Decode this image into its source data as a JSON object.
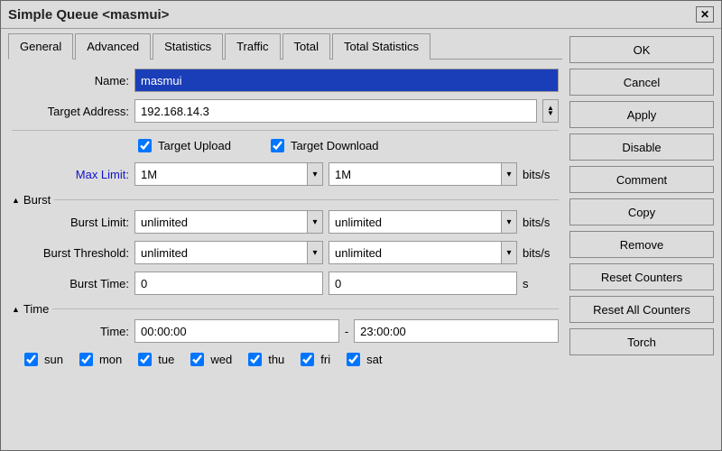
{
  "window": {
    "title": "Simple Queue <masmui>"
  },
  "tabs": [
    "General",
    "Advanced",
    "Statistics",
    "Traffic",
    "Total",
    "Total Statistics"
  ],
  "active_tab": 0,
  "labels": {
    "name": "Name:",
    "target_address": "Target Address:",
    "target_upload": "Target Upload",
    "target_download": "Target Download",
    "max_limit": "Max Limit:",
    "burst_section": "Burst",
    "burst_limit": "Burst Limit:",
    "burst_threshold": "Burst Threshold:",
    "burst_time": "Burst Time:",
    "time_section": "Time",
    "time": "Time:",
    "unit_bits": "bits/s",
    "unit_s": "s"
  },
  "fields": {
    "name": "masmui",
    "target_address": "192.168.14.3",
    "target_upload_checked": true,
    "target_download_checked": true,
    "max_limit_up": "1M",
    "max_limit_down": "1M",
    "burst_limit_up": "unlimited",
    "burst_limit_down": "unlimited",
    "burst_threshold_up": "unlimited",
    "burst_threshold_down": "unlimited",
    "burst_time_up": "0",
    "burst_time_down": "0",
    "time_from": "00:00:00",
    "time_to": "23:00:00"
  },
  "days": [
    {
      "key": "sun",
      "label": "sun",
      "checked": true
    },
    {
      "key": "mon",
      "label": "mon",
      "checked": true
    },
    {
      "key": "tue",
      "label": "tue",
      "checked": true
    },
    {
      "key": "wed",
      "label": "wed",
      "checked": true
    },
    {
      "key": "thu",
      "label": "thu",
      "checked": true
    },
    {
      "key": "fri",
      "label": "fri",
      "checked": true
    },
    {
      "key": "sat",
      "label": "sat",
      "checked": true
    }
  ],
  "buttons": {
    "ok": "OK",
    "cancel": "Cancel",
    "apply": "Apply",
    "disable": "Disable",
    "comment": "Comment",
    "copy": "Copy",
    "remove": "Remove",
    "reset_counters": "Reset Counters",
    "reset_all_counters": "Reset All Counters",
    "torch": "Torch"
  }
}
